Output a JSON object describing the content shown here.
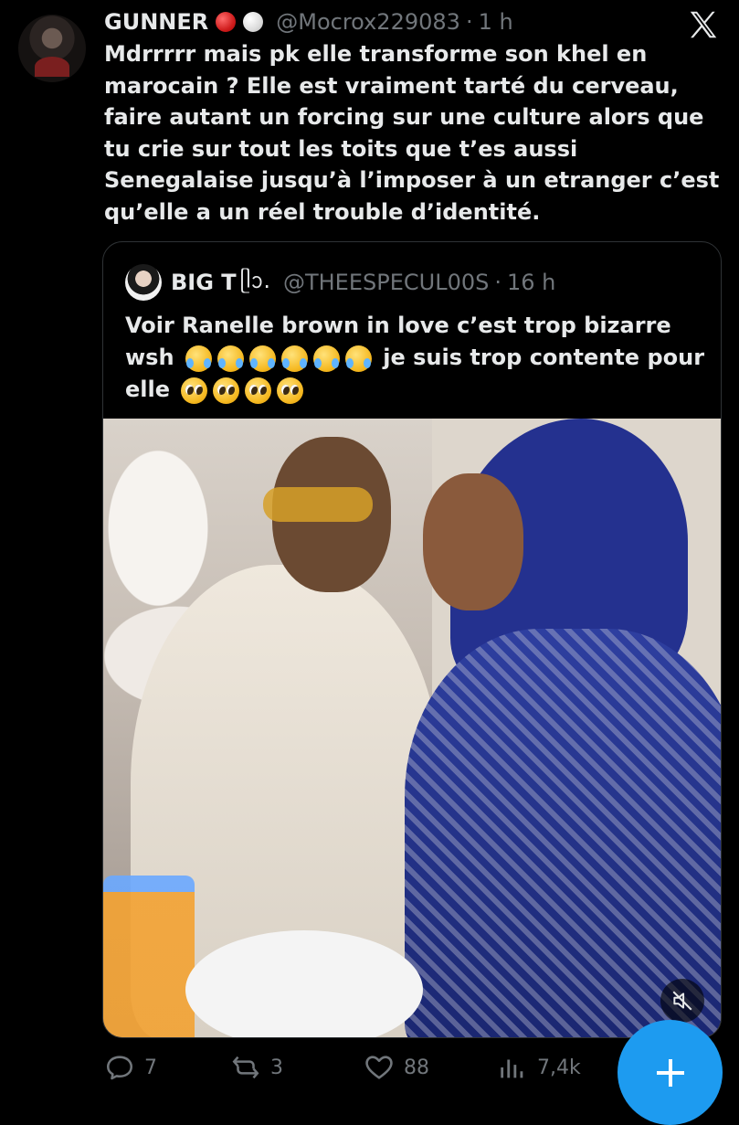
{
  "tweet": {
    "author_name": "GUNNER",
    "handle": "@Mocrox229083",
    "separator": "·",
    "time": "1 h",
    "text": "Mdrrrrr mais pk elle transforme son khel en marocain ? Elle est vraiment tarté du cerveau, faire autant un forcing sur une culture alors que tu crie sur tout les toits que t’es aussi Senegalaise jusqu’à l’imposer à un etranger c’est qu’elle a un réel trouble d’identité."
  },
  "quoted": {
    "author_name": "BIG T",
    "name_glyph": "ᥫᩣ.",
    "handle": "@THEESPECUL00S",
    "separator": "·",
    "time": "16 h",
    "text_part1": "Voir Ranelle brown in love c’est trop bizarre wsh",
    "text_part2": "je suis trop contente pour elle",
    "emoji_group1": [
      "😂",
      "😂",
      "😂",
      "😂",
      "😂",
      "😂"
    ],
    "emoji_group2": [
      "🥺",
      "🥺",
      "🥺",
      "🥺"
    ]
  },
  "actions": {
    "replies": "7",
    "reposts": "3",
    "likes": "88",
    "views": "7,4k"
  },
  "colors": {
    "background": "#000000",
    "text": "#e7e9ea",
    "muted": "#71767b",
    "accent": "#1d9bf0"
  },
  "icons": {
    "platform_logo": "x-logo-icon",
    "reply": "reply-icon",
    "repost": "repost-icon",
    "like": "heart-icon",
    "views": "views-icon",
    "mute": "mute-icon",
    "compose": "plus-icon"
  }
}
